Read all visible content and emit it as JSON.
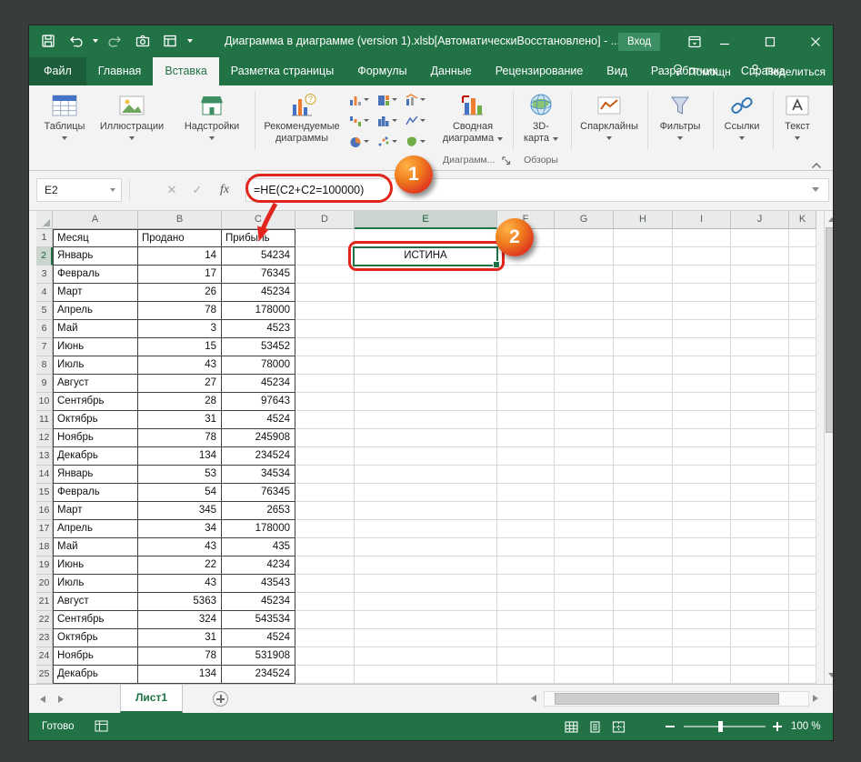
{
  "titlebar": {
    "title": "Диаграмма в диаграмме (version 1).xlsb[АвтоматическиВосстановлено]  - ...",
    "sign_in_label": "Вход"
  },
  "quick_access": {
    "icons": [
      "save",
      "undo",
      "redo",
      "screen-clip",
      "form",
      "customize-quick-access"
    ]
  },
  "ribbon": {
    "tabs": [
      {
        "label": "Файл",
        "file": true
      },
      {
        "label": "Главная"
      },
      {
        "label": "Вставка",
        "active": true
      },
      {
        "label": "Разметка страницы"
      },
      {
        "label": "Формулы"
      },
      {
        "label": "Данные"
      },
      {
        "label": "Рецензирование"
      },
      {
        "label": "Вид"
      },
      {
        "label": "Разработчик"
      },
      {
        "label": "Справка"
      }
    ],
    "right": {
      "help": "Помощн",
      "share": "Поделиться"
    },
    "groups": {
      "tables": "Таблицы",
      "illustrations": "Иллюстрации",
      "addins": "Надстройки",
      "recommended_line1": "Рекомендуемые",
      "recommended_line2": "диаграммы",
      "recommended_q": "?",
      "pivot_line1": "Сводная",
      "pivot_line2": "диаграмма",
      "map3d_line1": "3D-",
      "map3d_line2": "карта",
      "sparklines": "Спарклайны",
      "filters": "Фильтры",
      "links": "Ссылки",
      "text": "Текст",
      "charts_label": "Диаграмм...",
      "tours_label": "Обзоры"
    },
    "chart_buttons": [
      "column-chart",
      "treemap-chart",
      "combo-chart",
      "waterfall-chart",
      "histogram-chart",
      "line-chart",
      "pie-chart",
      "scatter-chart",
      "map-chart"
    ]
  },
  "formula_bar": {
    "name_box": "E2",
    "cancel": "✕",
    "enter": "✓",
    "fx": "fx",
    "formula": "=НЕ(C2+C2=100000)"
  },
  "grid": {
    "columns": [
      "A",
      "B",
      "C",
      "D",
      "E",
      "F",
      "G",
      "H",
      "I",
      "J",
      "K"
    ],
    "selected_column": "E",
    "selected_row": 2,
    "active_cell": "E2",
    "active_cell_value": "ИСТИНА",
    "cells": [
      [
        "Месяц",
        "Продано",
        "Прибыль"
      ],
      [
        "Январь",
        "14",
        "54234"
      ],
      [
        "Февраль",
        "17",
        "76345"
      ],
      [
        "Март",
        "26",
        "45234"
      ],
      [
        "Апрель",
        "78",
        "178000"
      ],
      [
        "Май",
        "3",
        "4523"
      ],
      [
        "Июнь",
        "15",
        "53452"
      ],
      [
        "Июль",
        "43",
        "78000"
      ],
      [
        "Август",
        "27",
        "45234"
      ],
      [
        "Сентябрь",
        "28",
        "97643"
      ],
      [
        "Октябрь",
        "31",
        "4524"
      ],
      [
        "Ноябрь",
        "78",
        "245908"
      ],
      [
        "Декабрь",
        "134",
        "234524"
      ],
      [
        "Январь",
        "53",
        "34534"
      ],
      [
        "Февраль",
        "54",
        "76345"
      ],
      [
        "Март",
        "345",
        "2653"
      ],
      [
        "Апрель",
        "34",
        "178000"
      ],
      [
        "Май",
        "43",
        "435"
      ],
      [
        "Июнь",
        "22",
        "4234"
      ],
      [
        "Июль",
        "43",
        "43543"
      ],
      [
        "Август",
        "5363",
        "45234"
      ],
      [
        "Сентябрь",
        "324",
        "543534"
      ],
      [
        "Октябрь",
        "31",
        "4524"
      ],
      [
        "Ноябрь",
        "78",
        "531908"
      ],
      [
        "Декабрь",
        "134",
        "234524"
      ]
    ]
  },
  "sheet_bar": {
    "tab": "Лист1"
  },
  "status_bar": {
    "ready": "Готово",
    "zoom": "100 %",
    "icons": [
      "macro-record",
      "normal-view",
      "page-layout-view",
      "page-break-preview",
      "zoom-out",
      "zoom-in"
    ]
  },
  "annotations": {
    "badge1": "1",
    "badge2": "2"
  }
}
